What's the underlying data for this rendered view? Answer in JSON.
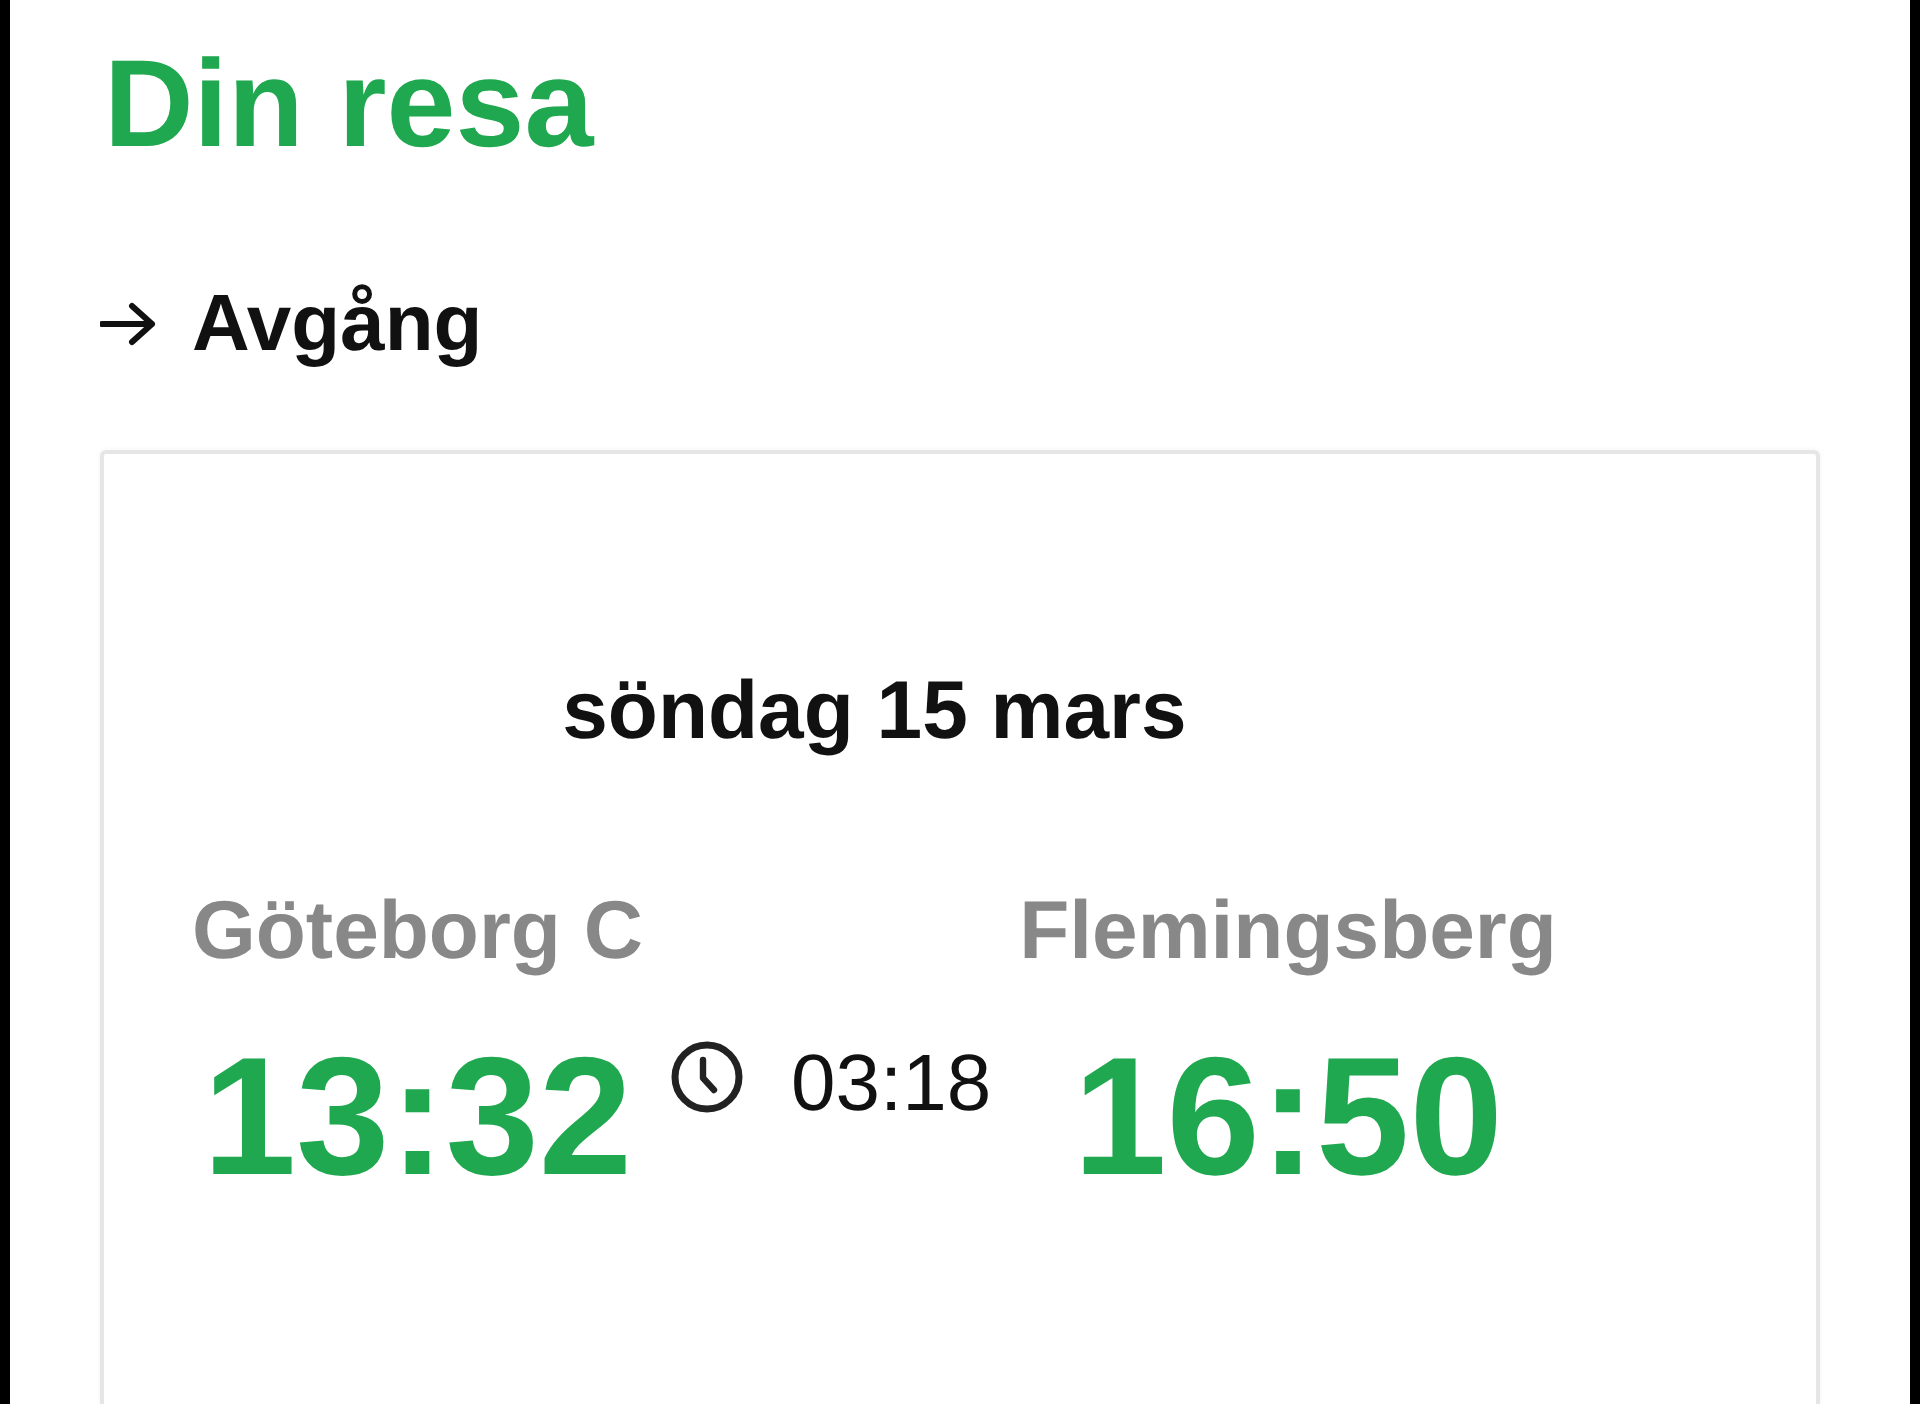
{
  "title": "Din resa",
  "direction": {
    "label": "Avgång"
  },
  "trip": {
    "date": "söndag 15 mars",
    "departure": {
      "station": "Göteborg C",
      "time": "13:32"
    },
    "duration": "03:18",
    "arrival": {
      "station": "Flemingsberg",
      "time": "16:50"
    }
  }
}
